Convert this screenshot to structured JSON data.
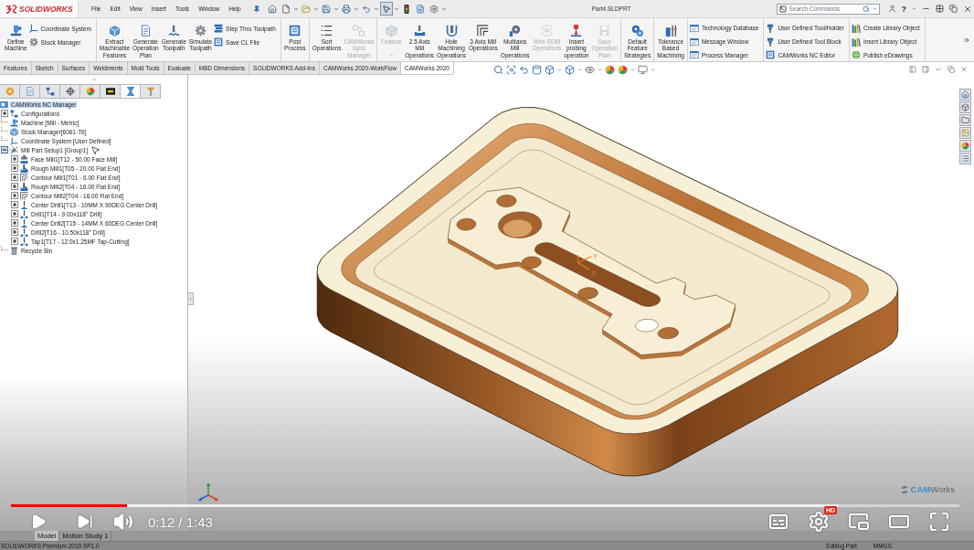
{
  "app_bar": {
    "logo": "SOLIDWORKS",
    "menus": [
      "File",
      "Edit",
      "View",
      "Insert",
      "Tools",
      "Window",
      "Help"
    ],
    "quick_access": [
      {
        "pressed": false
      },
      {
        "pressed": false
      },
      {
        "pressed": false
      },
      {
        "pressed": false
      },
      {
        "pressed": false
      },
      {
        "pressed": false
      },
      {
        "pressed": true
      },
      {
        "pressed": false
      },
      {
        "pressed": false
      },
      {
        "pressed": false
      }
    ],
    "title": "Part4.SLDPRT",
    "search": {
      "placeholder": "Search Commands"
    },
    "help": "?"
  },
  "ribbon_groups": [
    {
      "items": [
        {
          "kind": "large",
          "label": "Define\nMachine",
          "disabled": false
        },
        {
          "kind": "stack",
          "items": [
            {
              "label": "Coordinate System"
            },
            {
              "label": "Stock Manager"
            }
          ]
        }
      ]
    },
    {
      "items": [
        {
          "kind": "large",
          "label": "Extract\nMachinable\nFeatures",
          "disabled": false
        },
        {
          "kind": "large",
          "label": "Generate\nOperation\nPlan",
          "disabled": false
        },
        {
          "kind": "large",
          "label": "Generate\nToolpath",
          "disabled": false
        },
        {
          "kind": "large",
          "label": "Simulate\nToolpath",
          "disabled": false
        },
        {
          "kind": "stack",
          "items": [
            {
              "label": "Step Thru Toolpath"
            },
            {
              "label": "Save CL File"
            }
          ]
        }
      ]
    },
    {
      "items": [
        {
          "kind": "large",
          "label": "Post\nProcess",
          "disabled": false
        }
      ]
    },
    {
      "items": [
        {
          "kind": "large",
          "label": "Sort\nOperations",
          "disabled": false
        },
        {
          "kind": "large",
          "label": "CAMWorks\nSync\nManager",
          "disabled": true
        }
      ]
    },
    {
      "items": [
        {
          "kind": "split",
          "label": "Feature",
          "disabled": true
        },
        {
          "kind": "large",
          "label": "2.5 Axis\nMill\nOperations",
          "disabled": false
        },
        {
          "kind": "large",
          "label": "Hole\nMachining\nOperations",
          "disabled": false
        },
        {
          "kind": "large",
          "label": "3 Axis Mill\nOperations",
          "disabled": false
        },
        {
          "kind": "large",
          "label": "Multiaxis\nMill\nOperations",
          "disabled": false
        },
        {
          "kind": "large",
          "label": "Wire EDM\nOperations",
          "disabled": true
        },
        {
          "kind": "large",
          "label": "Insert\nprobing\noperation",
          "disabled": false
        },
        {
          "kind": "large",
          "label": "Save\nOperation\nPlan",
          "disabled": true
        }
      ]
    },
    {
      "items": [
        {
          "kind": "large",
          "label": "Default\nFeature\nStrategies",
          "disabled": false
        }
      ]
    },
    {
      "items": [
        {
          "kind": "large",
          "label": "Tolerance\nBased\nMachining",
          "disabled": false
        }
      ]
    },
    {
      "items": [
        {
          "kind": "stack",
          "items": [
            {
              "label": "Technology Database"
            },
            {
              "label": "Message Window"
            },
            {
              "label": "Process Manager"
            }
          ]
        }
      ]
    },
    {
      "items": [
        {
          "kind": "stack",
          "items": [
            {
              "label": "User Defined Tool/Holder"
            },
            {
              "label": "User Defined Tool Block"
            },
            {
              "label": "CAMWorks NC Editor"
            }
          ]
        }
      ]
    },
    {
      "items": [
        {
          "kind": "stack",
          "items": [
            {
              "label": "Create Library Object"
            },
            {
              "label": "Insert Library Object"
            },
            {
              "label": "Publish eDrawings"
            }
          ]
        }
      ]
    }
  ],
  "command_tabs": [
    {
      "label": "Features",
      "selected": false
    },
    {
      "label": "Sketch",
      "selected": false
    },
    {
      "label": "Surfaces",
      "selected": false
    },
    {
      "label": "Weldments",
      "selected": false
    },
    {
      "label": "Mold Tools",
      "selected": false
    },
    {
      "label": "Evaluate",
      "selected": false
    },
    {
      "label": "MBD Dimensions",
      "selected": false
    },
    {
      "label": "SOLIDWORKS Add-Ins",
      "selected": false
    },
    {
      "label": "CAMWorks 2020-WorkFlow",
      "selected": false
    },
    {
      "label": "CAMWorks 2020",
      "selected": true
    }
  ],
  "feature_tree": {
    "tabs": [
      {
        "selected": false
      },
      {
        "selected": false
      },
      {
        "selected": false
      },
      {
        "selected": false
      },
      {
        "selected": false
      },
      {
        "selected": false
      },
      {
        "selected": true
      },
      {
        "selected": false
      }
    ],
    "items": [
      {
        "label": "CAMWorks NC Manager",
        "selected": true,
        "children": [
          {
            "label": "Configurations",
            "selected": false,
            "expanded": false
          },
          {
            "label": "Machine [Mill - Metric]",
            "selected": false
          },
          {
            "label": "Stock Manager[6061-T6]",
            "selected": false
          },
          {
            "label": "Coordinate System [User Defined]",
            "selected": false
          },
          {
            "label": "Mill Part Setup1 [Group1]",
            "selected": false,
            "expanded": true,
            "children": [
              {
                "label": "Face Mill1[T12 - 50.00 Face Mill]",
                "selected": false,
                "expanded": false
              },
              {
                "label": "Rough Mill1[T05 - 20.00 Flat End]",
                "selected": false,
                "expanded": false
              },
              {
                "label": "Contour Mill1[T01 - 6.00 Flat End]",
                "selected": false,
                "expanded": false
              },
              {
                "label": "Rough Mill2[T04 - 16.00 Flat End]",
                "selected": false,
                "expanded": false
              },
              {
                "label": "Contour Mill2[T04 - 16.00 Flat End]",
                "selected": false,
                "expanded": false
              },
              {
                "label": "Center Drill1[T13 - 10MM X 90DEG Center Drill]",
                "selected": false,
                "expanded": false
              },
              {
                "label": "Drill1[T14 - 9.00x118° Drill]",
                "selected": false,
                "expanded": false
              },
              {
                "label": "Center Drill2[T15 - 14MM X 60DEG Center Drill]",
                "selected": false,
                "expanded": false
              },
              {
                "label": "Drill2[T16 - 10.50x118° Drill]",
                "selected": false,
                "expanded": false
              },
              {
                "label": "Tap1[T17 - 12.0x1.25MF Tap-Cutting]",
                "selected": false,
                "expanded": false
              }
            ]
          },
          {
            "label": "Recycle Bin",
            "selected": false
          }
        ]
      }
    ]
  },
  "graphics": {
    "origin_labels": {
      "x": "X",
      "y": "Y"
    },
    "brand_logo": "**CAM**Works"
  },
  "model_tabs": [
    {
      "label": "Model",
      "selected": true
    },
    {
      "label": "Motion Study 1",
      "selected": false
    }
  ],
  "status_bar": {
    "product": "SOLIDWORKS Premium 2019 SP1.0",
    "state": "Editing Part",
    "units": "MMGS"
  },
  "player": {
    "paused": true,
    "progress": {
      "level": 0.122
    },
    "buffer": {
      "level": 0.873
    },
    "time": "0:12 / 1:43",
    "quality_badge": "HD"
  }
}
